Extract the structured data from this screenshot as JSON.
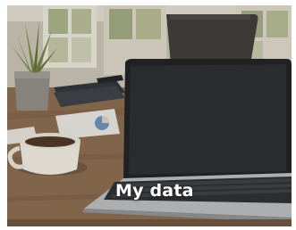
{
  "tile": {
    "caption": "My data",
    "image_subject": "laptop-on-desk",
    "caption_color": "#ffffff"
  }
}
